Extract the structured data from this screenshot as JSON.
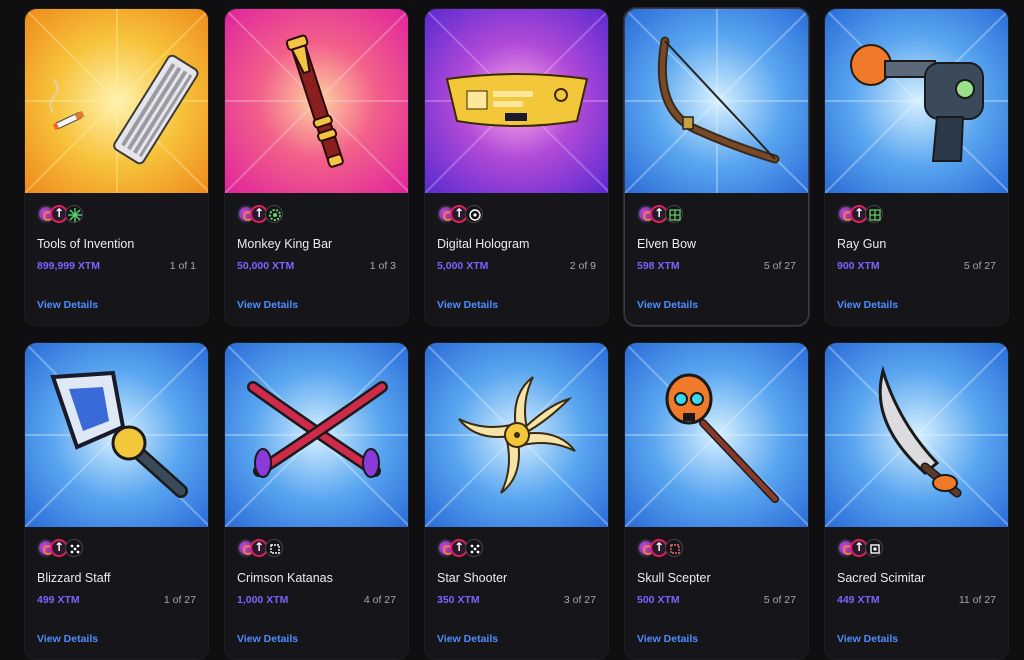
{
  "cards": [
    {
      "name": "Tools of Invention",
      "price": "899,999 XTM",
      "count": "1 of 1",
      "details": "View Details",
      "bg": "yellow",
      "item": "keyboard-cigarette",
      "badge3": "sparkle"
    },
    {
      "name": "Monkey King Bar",
      "price": "50,000 XTM",
      "count": "1 of 3",
      "details": "View Details",
      "bg": "pink",
      "item": "golden-staff",
      "badge3": "gear"
    },
    {
      "name": "Digital Hologram",
      "price": "5,000 XTM",
      "count": "2 of 9",
      "details": "View Details",
      "bg": "purple",
      "item": "hologram-visor",
      "badge3": "target"
    },
    {
      "name": "Elven Bow",
      "price": "598 XTM",
      "count": "5 of 27",
      "details": "View Details",
      "bg": "blue",
      "item": "bow",
      "badge3": "grid"
    },
    {
      "name": "Ray Gun",
      "price": "900 XTM",
      "count": "5 of 27",
      "details": "View Details",
      "bg": "blue",
      "item": "ray-gun",
      "badge3": "grid"
    },
    {
      "name": "Blizzard Staff",
      "price": "499 XTM",
      "count": "1 of 27",
      "details": "View Details",
      "bg": "blue",
      "item": "blizzard-staff",
      "badge3": "dots"
    },
    {
      "name": "Crimson Katanas",
      "price": "1,000 XTM",
      "count": "4 of 27",
      "details": "View Details",
      "bg": "blue",
      "item": "crossed-katanas",
      "badge3": "square"
    },
    {
      "name": "Star Shooter",
      "price": "350 XTM",
      "count": "3 of 27",
      "details": "View Details",
      "bg": "blue",
      "item": "shuriken",
      "badge3": "dots"
    },
    {
      "name": "Skull Scepter",
      "price": "500 XTM",
      "count": "5 of 27",
      "details": "View Details",
      "bg": "blue",
      "item": "skull-scepter",
      "badge3": "square"
    },
    {
      "name": "Sacred Scimitar",
      "price": "449 XTM",
      "count": "11 of 27",
      "details": "View Details",
      "bg": "blue",
      "item": "scimitar",
      "badge3": "square"
    }
  ],
  "colors": {
    "price": "#7b63ff",
    "link": "#4d8dff",
    "yellow": "#f0b22a",
    "pink": "#e83aa0",
    "purple": "#7a3bd8",
    "blue": "#3a86ea"
  }
}
